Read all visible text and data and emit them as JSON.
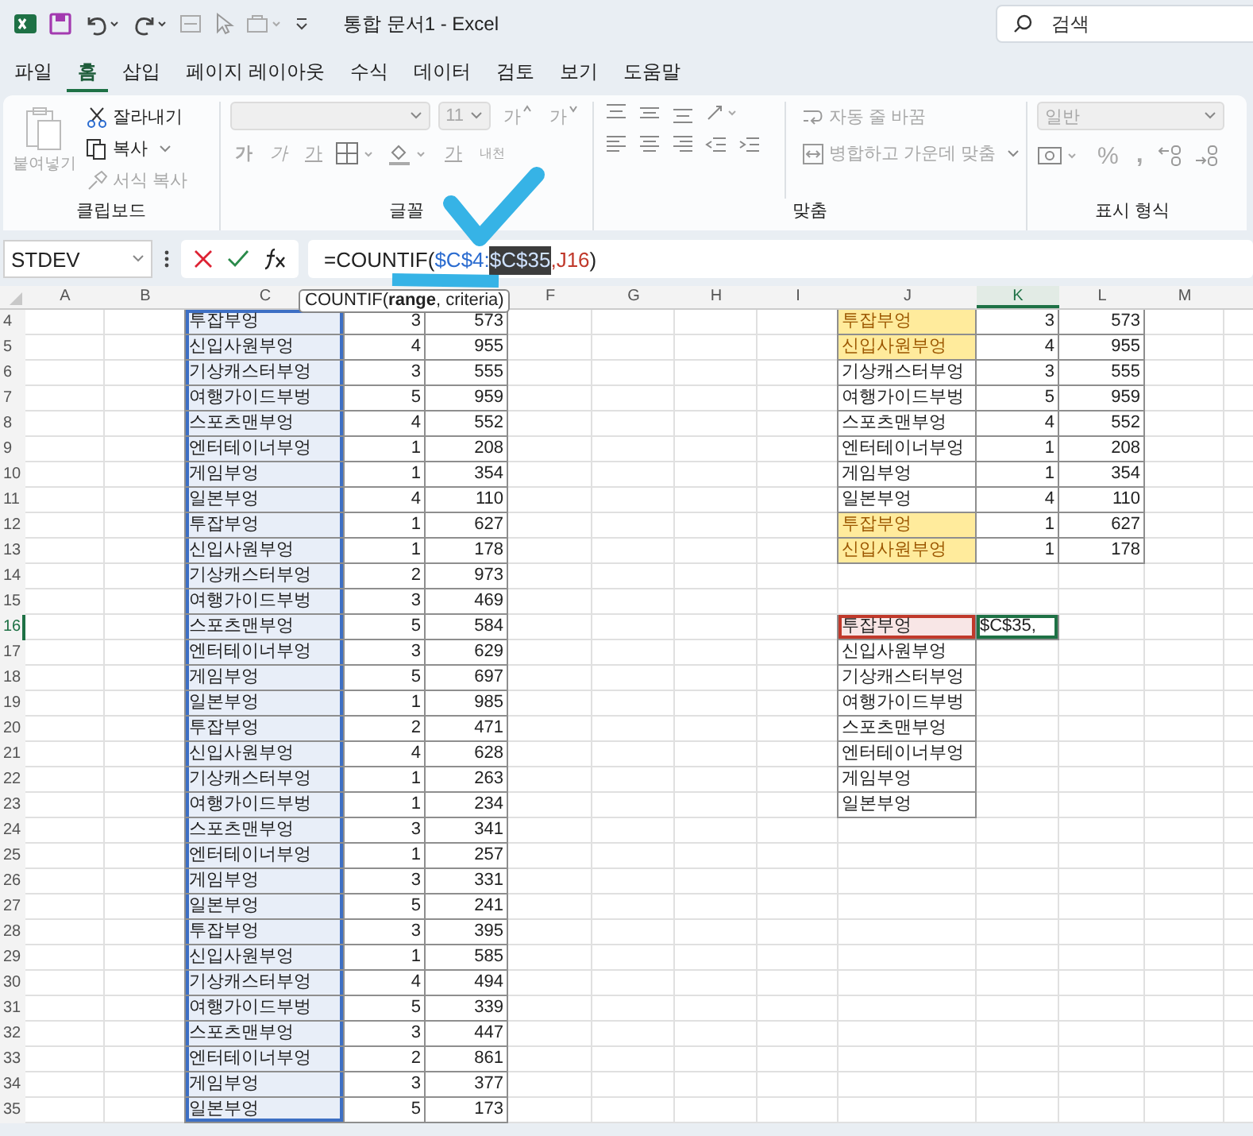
{
  "window": {
    "title": "통합 문서1  -  Excel"
  },
  "search": {
    "placeholder": "검색"
  },
  "tabs": [
    {
      "label": "파일",
      "selected": false
    },
    {
      "label": "홈",
      "selected": true
    },
    {
      "label": "삽입",
      "selected": false
    },
    {
      "label": "페이지 레이아웃",
      "selected": false
    },
    {
      "label": "수식",
      "selected": false
    },
    {
      "label": "데이터",
      "selected": false
    },
    {
      "label": "검토",
      "selected": false
    },
    {
      "label": "보기",
      "selected": false
    },
    {
      "label": "도움말",
      "selected": false
    }
  ],
  "ribbon": {
    "clipboard": {
      "label": "클립보드",
      "paste": {
        "label": "붙여넣기",
        "disabled": true
      },
      "cut": {
        "label": "잘라내기",
        "disabled": false
      },
      "copy": {
        "label": "복사",
        "disabled": false
      },
      "format_painter": {
        "label": "서식 복사",
        "disabled": true
      }
    },
    "font": {
      "label": "글꼴",
      "disabled": true,
      "font_size": "11",
      "grow": "가",
      "shrink": "가",
      "bold": "가",
      "italic": "가",
      "underline": "가",
      "font_color": "가",
      "phonetic": "내천"
    },
    "alignment": {
      "label": "맞춤",
      "disabled": true,
      "wrap_text": "자동 줄 바꿈",
      "merge_center": "병합하고 가운데 맞춤"
    },
    "number": {
      "label": "표시 형식",
      "disabled": true,
      "format": "일반",
      "percent": "%",
      "comma": ","
    }
  },
  "formula_bar": {
    "name_box": "STDEV",
    "formula": [
      {
        "kind": "plain",
        "text": "=COUNTIF("
      },
      {
        "kind": "ref",
        "text": "$C$4:"
      },
      {
        "kind": "selected",
        "text": "$C$35"
      },
      {
        "kind": "ref2",
        "text": ",J16"
      },
      {
        "kind": "plain",
        "text": ")"
      }
    ]
  },
  "tooltip": "COUNTIF(**range**, criteria)",
  "columns": [
    {
      "kind": "label",
      "label": "A",
      "selected": false
    },
    {
      "kind": "label",
      "label": "B",
      "selected": false
    },
    {
      "kind": "label",
      "label": "C",
      "selected": false
    },
    {
      "kind": "covered"
    },
    {
      "kind": "covered"
    },
    {
      "kind": "label",
      "label": "F",
      "selected": false
    },
    {
      "kind": "label",
      "label": "G",
      "selected": false
    },
    {
      "kind": "label",
      "label": "H",
      "selected": false
    },
    {
      "kind": "label",
      "label": "I",
      "selected": false
    },
    {
      "kind": "label",
      "label": "J",
      "selected": false
    },
    {
      "kind": "label",
      "label": "K",
      "selected": true
    },
    {
      "kind": "label",
      "label": "L",
      "selected": false
    },
    {
      "kind": "label",
      "label": "M",
      "selected": false
    }
  ],
  "row_numbers": [
    {
      "label": "4",
      "selected": false
    },
    {
      "label": "5",
      "selected": false
    },
    {
      "label": "6",
      "selected": false
    },
    {
      "label": "7",
      "selected": false
    },
    {
      "label": "8",
      "selected": false
    },
    {
      "label": "9",
      "selected": false
    },
    {
      "label": "10",
      "selected": false
    },
    {
      "label": "11",
      "selected": false
    },
    {
      "label": "12",
      "selected": false
    },
    {
      "label": "13",
      "selected": false
    },
    {
      "label": "14",
      "selected": false
    },
    {
      "label": "15",
      "selected": false
    },
    {
      "label": "16",
      "selected": true
    },
    {
      "label": "17",
      "selected": false
    },
    {
      "label": "18",
      "selected": false
    },
    {
      "label": "19",
      "selected": false
    },
    {
      "label": "20",
      "selected": false
    },
    {
      "label": "21",
      "selected": false
    },
    {
      "label": "22",
      "selected": false
    },
    {
      "label": "23",
      "selected": false
    },
    {
      "label": "24",
      "selected": false
    },
    {
      "label": "25",
      "selected": false
    },
    {
      "label": "26",
      "selected": false
    },
    {
      "label": "27",
      "selected": false
    },
    {
      "label": "28",
      "selected": false
    },
    {
      "label": "29",
      "selected": false
    },
    {
      "label": "30",
      "selected": false
    },
    {
      "label": "31",
      "selected": false
    },
    {
      "label": "32",
      "selected": false
    },
    {
      "label": "33",
      "selected": false
    },
    {
      "label": "34",
      "selected": false
    },
    {
      "label": "35",
      "selected": false
    }
  ],
  "main_table": {
    "range_selected": true,
    "rows": [
      {
        "name": "투잡부엉",
        "count": "3",
        "value": "573"
      },
      {
        "name": "신입사원부엉",
        "count": "4",
        "value": "955"
      },
      {
        "name": "기상캐스터부엉",
        "count": "3",
        "value": "555"
      },
      {
        "name": "여행가이드부벙",
        "count": "5",
        "value": "959"
      },
      {
        "name": "스포츠맨부엉",
        "count": "4",
        "value": "552"
      },
      {
        "name": "엔터테이너부엉",
        "count": "1",
        "value": "208"
      },
      {
        "name": "게임부엉",
        "count": "1",
        "value": "354"
      },
      {
        "name": "일본부엉",
        "count": "4",
        "value": "110"
      },
      {
        "name": "투잡부엉",
        "count": "1",
        "value": "627"
      },
      {
        "name": "신입사원부엉",
        "count": "1",
        "value": "178"
      },
      {
        "name": "기상캐스터부엉",
        "count": "2",
        "value": "973"
      },
      {
        "name": "여행가이드부벙",
        "count": "3",
        "value": "469"
      },
      {
        "name": "스포츠맨부엉",
        "count": "5",
        "value": "584"
      },
      {
        "name": "엔터테이너부엉",
        "count": "3",
        "value": "629"
      },
      {
        "name": "게임부엉",
        "count": "5",
        "value": "697"
      },
      {
        "name": "일본부엉",
        "count": "1",
        "value": "985"
      },
      {
        "name": "투잡부엉",
        "count": "2",
        "value": "471"
      },
      {
        "name": "신입사원부엉",
        "count": "4",
        "value": "628"
      },
      {
        "name": "기상캐스터부엉",
        "count": "1",
        "value": "263"
      },
      {
        "name": "여행가이드부벙",
        "count": "1",
        "value": "234"
      },
      {
        "name": "스포츠맨부엉",
        "count": "3",
        "value": "341"
      },
      {
        "name": "엔터테이너부엉",
        "count": "1",
        "value": "257"
      },
      {
        "name": "게임부엉",
        "count": "3",
        "value": "331"
      },
      {
        "name": "일본부엉",
        "count": "5",
        "value": "241"
      },
      {
        "name": "투잡부엉",
        "count": "3",
        "value": "395"
      },
      {
        "name": "신입사원부엉",
        "count": "1",
        "value": "585"
      },
      {
        "name": "기상캐스터부엉",
        "count": "4",
        "value": "494"
      },
      {
        "name": "여행가이드부벙",
        "count": "5",
        "value": "339"
      },
      {
        "name": "스포츠맨부엉",
        "count": "3",
        "value": "447"
      },
      {
        "name": "엔터테이너부엉",
        "count": "2",
        "value": "861"
      },
      {
        "name": "게임부엉",
        "count": "3",
        "value": "377"
      },
      {
        "name": "일본부엉",
        "count": "5",
        "value": "173"
      }
    ]
  },
  "summary_table": {
    "rows": [
      {
        "name": "투잡부엉",
        "count": "3",
        "value": "573",
        "highlighted": true
      },
      {
        "name": "신입사원부엉",
        "count": "4",
        "value": "955",
        "highlighted": true
      },
      {
        "name": "기상캐스터부엉",
        "count": "3",
        "value": "555",
        "highlighted": false
      },
      {
        "name": "여행가이드부벙",
        "count": "5",
        "value": "959",
        "highlighted": false
      },
      {
        "name": "스포츠맨부엉",
        "count": "4",
        "value": "552",
        "highlighted": false
      },
      {
        "name": "엔터테이너부엉",
        "count": "1",
        "value": "208",
        "highlighted": false
      },
      {
        "name": "게임부엉",
        "count": "1",
        "value": "354",
        "highlighted": false
      },
      {
        "name": "일본부엉",
        "count": "4",
        "value": "110",
        "highlighted": false
      },
      {
        "name": "투잡부엉",
        "count": "1",
        "value": "627",
        "highlighted": true
      },
      {
        "name": "신입사원부엉",
        "count": "1",
        "value": "178",
        "highlighted": true
      }
    ]
  },
  "criteria_list": {
    "items": [
      {
        "name": "투잡부엉",
        "selected": true
      },
      {
        "name": "신입사원부엉",
        "selected": false
      },
      {
        "name": "기상캐스터부엉",
        "selected": false
      },
      {
        "name": "여행가이드부벙",
        "selected": false
      },
      {
        "name": "스포츠맨부엉",
        "selected": false
      },
      {
        "name": "엔터테이너부엉",
        "selected": false
      },
      {
        "name": "게임부엉",
        "selected": false
      },
      {
        "name": "일본부엉",
        "selected": false
      }
    ]
  },
  "active_cell": {
    "text": "$C$35,"
  }
}
